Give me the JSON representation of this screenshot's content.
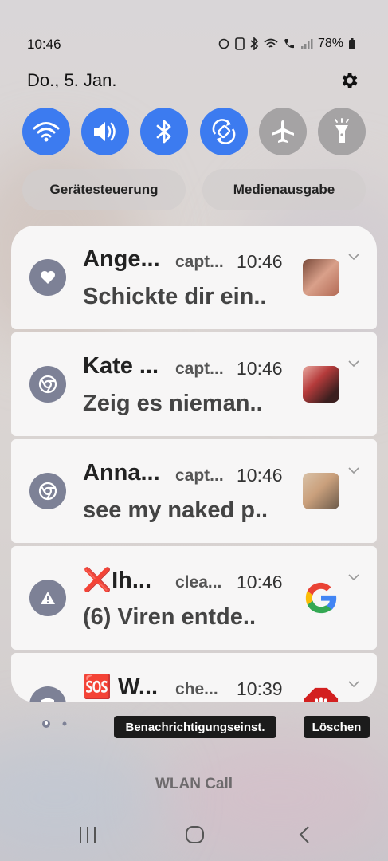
{
  "status_bar": {
    "time": "10:46",
    "battery": "78%"
  },
  "header": {
    "date": "Do., 5. Jan."
  },
  "quick_settings": [
    {
      "name": "wifi",
      "state": "on",
      "icon": "wifi-icon"
    },
    {
      "name": "sound",
      "state": "on",
      "icon": "volume-icon"
    },
    {
      "name": "bluetooth",
      "state": "on",
      "icon": "bluetooth-icon"
    },
    {
      "name": "auto-rotate",
      "state": "on",
      "icon": "rotate-icon"
    },
    {
      "name": "airplane",
      "state": "off",
      "icon": "airplane-icon"
    },
    {
      "name": "flashlight",
      "state": "off",
      "icon": "flashlight-icon"
    }
  ],
  "pills": {
    "device_control": "Gerätesteuerung",
    "media_output": "Medienausgabe"
  },
  "notifications": [
    {
      "title": "Ange...",
      "app": "capt...",
      "time": "10:46",
      "body": "Schickte dir ein..",
      "icon": "heart-icon"
    },
    {
      "title": "Kate ...",
      "app": "capt...",
      "time": "10:46",
      "body": "Zeig es nieman..",
      "icon": "chrome-icon"
    },
    {
      "title": "Anna...",
      "app": "capt...",
      "time": "10:46",
      "body": "see my naked p..",
      "icon": "chrome-icon"
    },
    {
      "title": "❌Ih...",
      "app": "clea...",
      "time": "10:46",
      "body": "(6) Viren entde..",
      "icon": "warning-icon"
    },
    {
      "title": "🆘 W...",
      "app": "che...",
      "time": "10:39",
      "body": "",
      "icon": "shield-icon"
    }
  ],
  "actions": {
    "notification_settings": "Benachrichtigungseinst.",
    "clear": "Löschen"
  },
  "footer": {
    "carrier_label": "WLAN Call"
  },
  "colors": {
    "accent": "#3c7bf0",
    "inactive": "#a5a3a4",
    "card": "#f7f6f6"
  }
}
